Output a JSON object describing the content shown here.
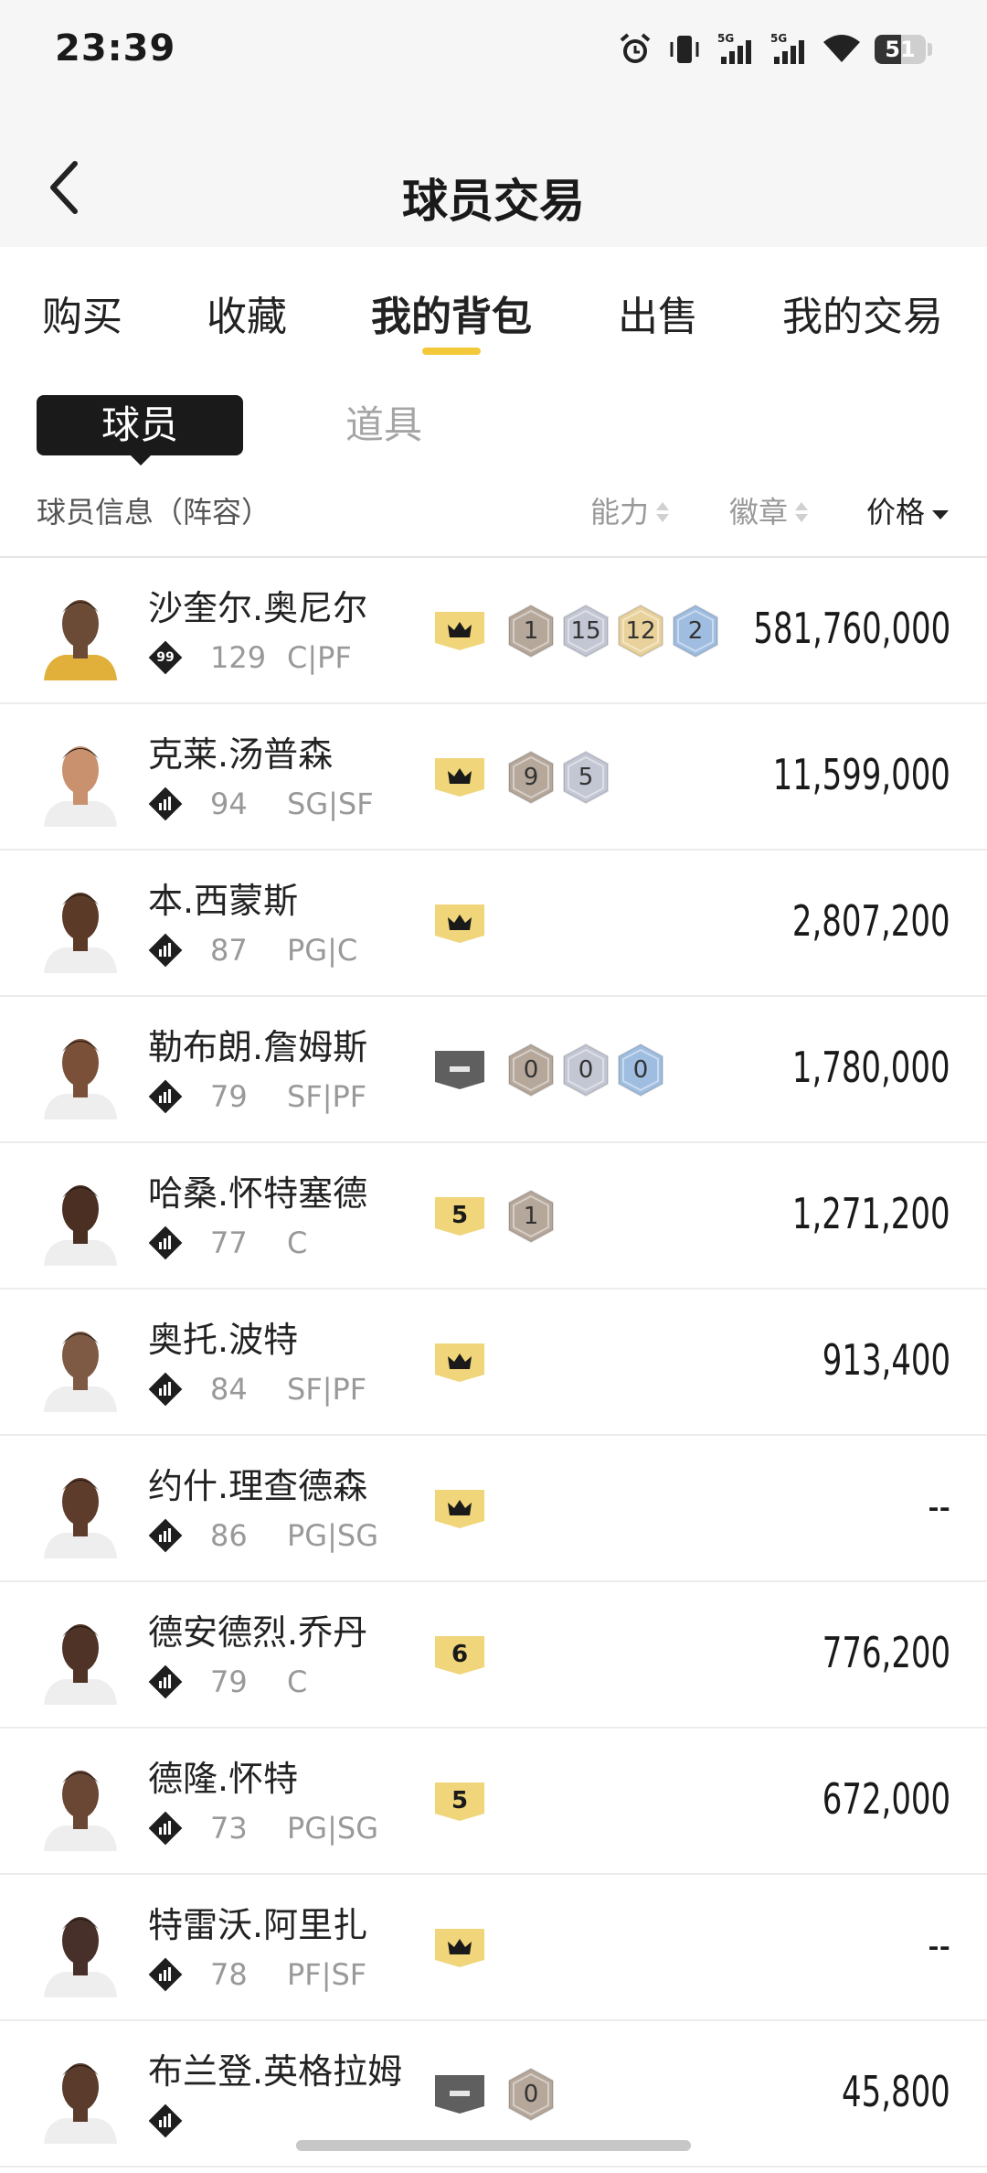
{
  "status_bar": {
    "time": "23:39",
    "battery": "51",
    "battery_level": 0.51,
    "icons": [
      "alarm-icon",
      "vibrate-icon",
      "signal-5g-icon",
      "signal-5g-icon",
      "wifi-icon",
      "battery-icon"
    ],
    "signal_label": "5G"
  },
  "header": {
    "title": "球员交易",
    "back_icon": "chevron-left-icon"
  },
  "tabs": [
    {
      "label": "购买",
      "active": false
    },
    {
      "label": "收藏",
      "active": false
    },
    {
      "label": "我的背包",
      "active": true
    },
    {
      "label": "出售",
      "active": false
    },
    {
      "label": "我的交易",
      "active": false
    }
  ],
  "segment": {
    "active": "球员",
    "inactive": "道具"
  },
  "columns": {
    "info": "球员信息（阵容）",
    "ability": "能力",
    "badge": "徽章",
    "price": "价格"
  },
  "colors": {
    "accent": "#f3c93b",
    "gold_card": "#f0d57a",
    "gray_card": "#5f5f5f",
    "hex_bronze": "#b5a79a",
    "hex_silver": "#c3c6d3",
    "hex_gold": "#e8d19a",
    "hex_blue": "#9fbde0"
  },
  "players": [
    {
      "name": "沙奎尔.奥尼尔",
      "tier": "99",
      "rating": "129",
      "position": "C|PF",
      "card": {
        "type": "gold",
        "label": "crown"
      },
      "badges": [
        {
          "value": "1",
          "color": "bronze"
        },
        {
          "value": "15",
          "color": "silver"
        },
        {
          "value": "12",
          "color": "gold"
        },
        {
          "value": "2",
          "color": "blue"
        }
      ],
      "price": "581,760,000"
    },
    {
      "name": "克莱.汤普森",
      "tier": "",
      "rating": "94",
      "position": "SG|SF",
      "card": {
        "type": "gold",
        "label": "crown"
      },
      "badges": [
        {
          "value": "9",
          "color": "bronze"
        },
        {
          "value": "5",
          "color": "silver"
        }
      ],
      "price": "11,599,000"
    },
    {
      "name": "本.西蒙斯",
      "tier": "",
      "rating": "87",
      "position": "PG|C",
      "card": {
        "type": "gold",
        "label": "crown"
      },
      "badges": [],
      "price": "2,807,200"
    },
    {
      "name": "勒布朗.詹姆斯",
      "tier": "",
      "rating": "79",
      "position": "SF|PF",
      "card": {
        "type": "gray",
        "label": "dash"
      },
      "badges": [
        {
          "value": "0",
          "color": "bronze"
        },
        {
          "value": "0",
          "color": "silver"
        },
        {
          "value": "0",
          "color": "blue"
        }
      ],
      "price": "1,780,000"
    },
    {
      "name": "哈桑.怀特塞德",
      "tier": "",
      "rating": "77",
      "position": "C",
      "card": {
        "type": "gold",
        "label": "5"
      },
      "badges": [
        {
          "value": "1",
          "color": "bronze"
        }
      ],
      "price": "1,271,200"
    },
    {
      "name": "奥托.波特",
      "tier": "",
      "rating": "84",
      "position": "SF|PF",
      "card": {
        "type": "gold",
        "label": "crown"
      },
      "badges": [],
      "price": "913,400"
    },
    {
      "name": "约什.理查德森",
      "tier": "",
      "rating": "86",
      "position": "PG|SG",
      "card": {
        "type": "gold",
        "label": "crown"
      },
      "badges": [],
      "price": "--"
    },
    {
      "name": "德安德烈.乔丹",
      "tier": "",
      "rating": "79",
      "position": "C",
      "card": {
        "type": "gold",
        "label": "6"
      },
      "badges": [],
      "price": "776,200"
    },
    {
      "name": "德隆.怀特",
      "tier": "",
      "rating": "73",
      "position": "PG|SG",
      "card": {
        "type": "gold",
        "label": "5"
      },
      "badges": [],
      "price": "672,000"
    },
    {
      "name": "特雷沃.阿里扎",
      "tier": "",
      "rating": "78",
      "position": "PF|SF",
      "card": {
        "type": "gold",
        "label": "crown"
      },
      "badges": [],
      "price": "--"
    },
    {
      "name": "布兰登.英格拉姆",
      "tier": "",
      "rating": "",
      "position": "",
      "card": {
        "type": "gray",
        "label": "dash"
      },
      "badges": [
        {
          "value": "0",
          "color": "bronze"
        }
      ],
      "price": "45,800"
    }
  ]
}
